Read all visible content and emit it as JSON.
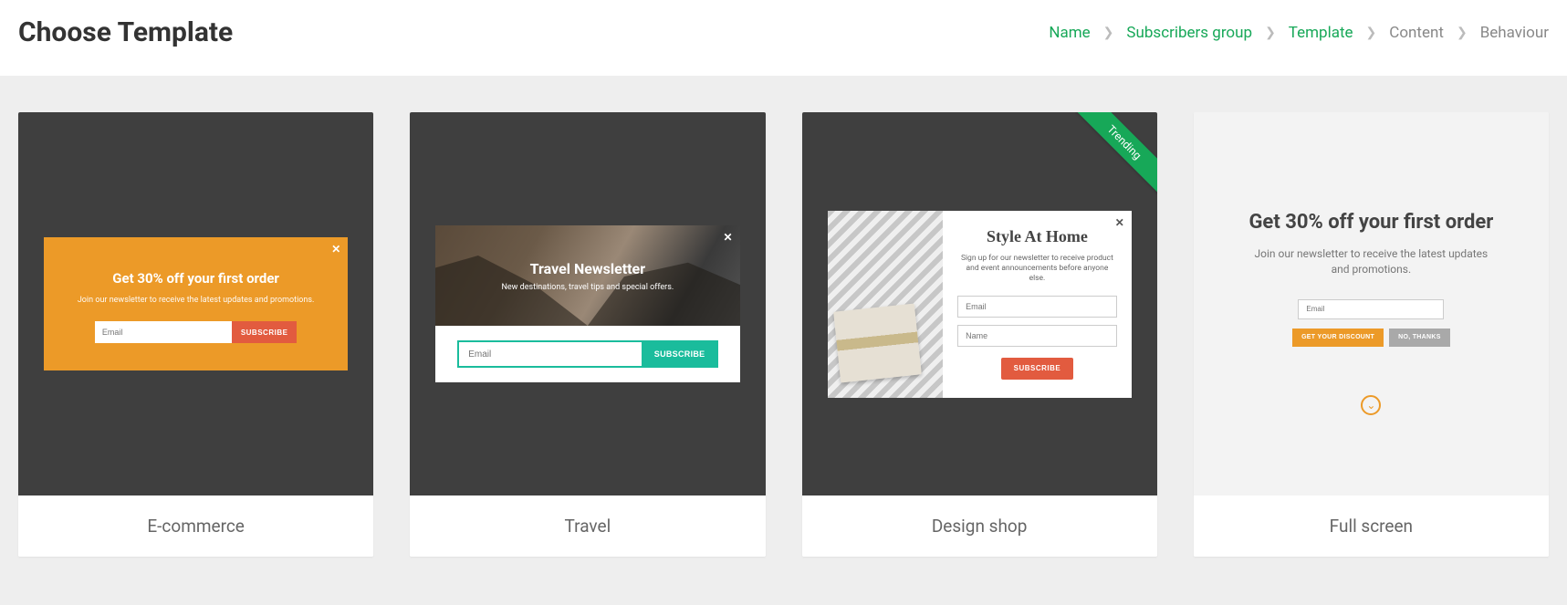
{
  "header": {
    "title": "Choose Template",
    "steps": [
      {
        "label": "Name",
        "done": true
      },
      {
        "label": "Subscribers group",
        "done": true
      },
      {
        "label": "Template",
        "done": true
      },
      {
        "label": "Content",
        "done": false
      },
      {
        "label": "Behaviour",
        "done": false
      }
    ]
  },
  "templates": {
    "ecommerce": {
      "title": "E-commerce",
      "popup": {
        "heading": "Get 30% off your first order",
        "sub": "Join our newsletter to receive the latest updates and promotions.",
        "email_placeholder": "Email",
        "button": "SUBSCRIBE"
      }
    },
    "travel": {
      "title": "Travel",
      "popup": {
        "heading": "Travel Newsletter",
        "sub": "New destinations, travel tips and special offers.",
        "email_placeholder": "Email",
        "button": "SUBSCRIBE"
      }
    },
    "design": {
      "title": "Design shop",
      "ribbon": "Trending",
      "popup": {
        "heading": "Style At Home",
        "sub": "Sign up for our newsletter to receive product and event announcements before anyone else.",
        "email_placeholder": "Email",
        "name_placeholder": "Name",
        "button": "SUBSCRIBE"
      }
    },
    "full": {
      "title": "Full screen",
      "popup": {
        "heading": "Get 30% off your first order",
        "sub": "Join our newsletter to receive the latest updates and promotions.",
        "email_placeholder": "Email",
        "primary": "GET YOUR DISCOUNT",
        "secondary": "NO, THANKS"
      }
    }
  }
}
